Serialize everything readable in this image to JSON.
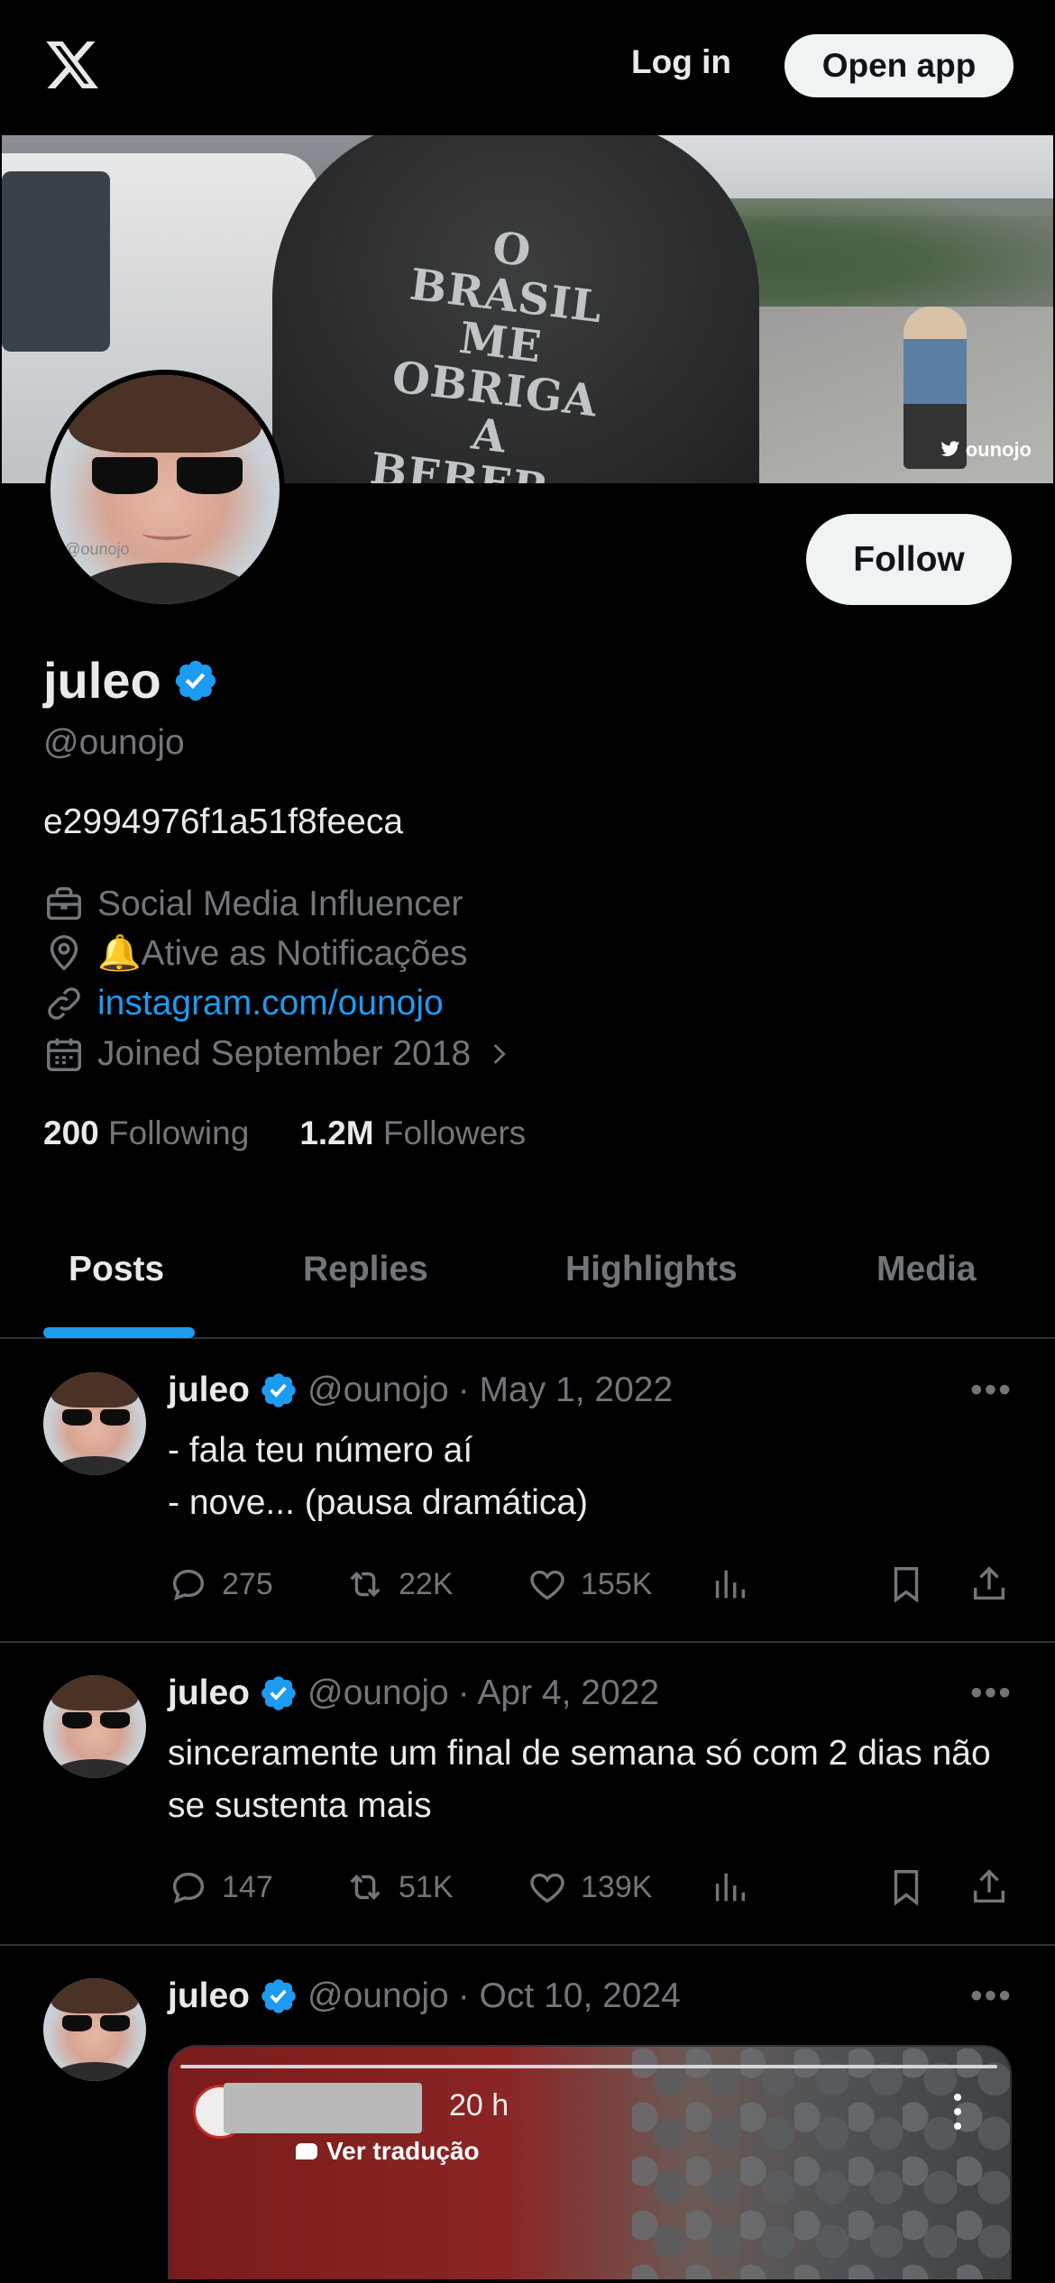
{
  "colors": {
    "accent": "#1d9bf0",
    "background": "#000000",
    "text": "#e7e9ea",
    "muted": "#71767b",
    "divider": "#2f3336"
  },
  "topbar": {
    "login_label": "Log in",
    "open_app_label": "Open app"
  },
  "banner": {
    "shirt_text": "O BRASIL ME OBRIGA A BEBER...",
    "watermark": "ounojo"
  },
  "avatar_tag": "@ounojo",
  "profile": {
    "follow_label": "Follow",
    "name": "juleo",
    "handle": "@ounojo",
    "bio": "e2994976f1a51f8feeca",
    "category": "Social Media Influencer",
    "location": "🔔Ative as Notificações",
    "website": "instagram.com/ounojo",
    "joined": "Joined September 2018",
    "following_count": "200",
    "following_label": "Following",
    "followers_count": "1.2M",
    "followers_label": "Followers"
  },
  "tabs": [
    "Posts",
    "Replies",
    "Highlights",
    "Media"
  ],
  "posts": [
    {
      "name": "juleo",
      "handle": "@ounojo",
      "date": "· May 1, 2022",
      "text": "- fala teu número aí\n- nove... (pausa dramática)",
      "replies": "275",
      "reposts": "22K",
      "likes": "155K"
    },
    {
      "name": "juleo",
      "handle": "@ounojo",
      "date": "· Apr 4, 2022",
      "text": "sinceramente  um final de semana só com 2 dias não se sustenta mais",
      "replies": "147",
      "reposts": "51K",
      "likes": "139K"
    },
    {
      "name": "juleo",
      "handle": "@ounojo",
      "date": "· Oct 10, 2024",
      "media_time": "20 h",
      "media_caption": "Ver tradução"
    }
  ]
}
